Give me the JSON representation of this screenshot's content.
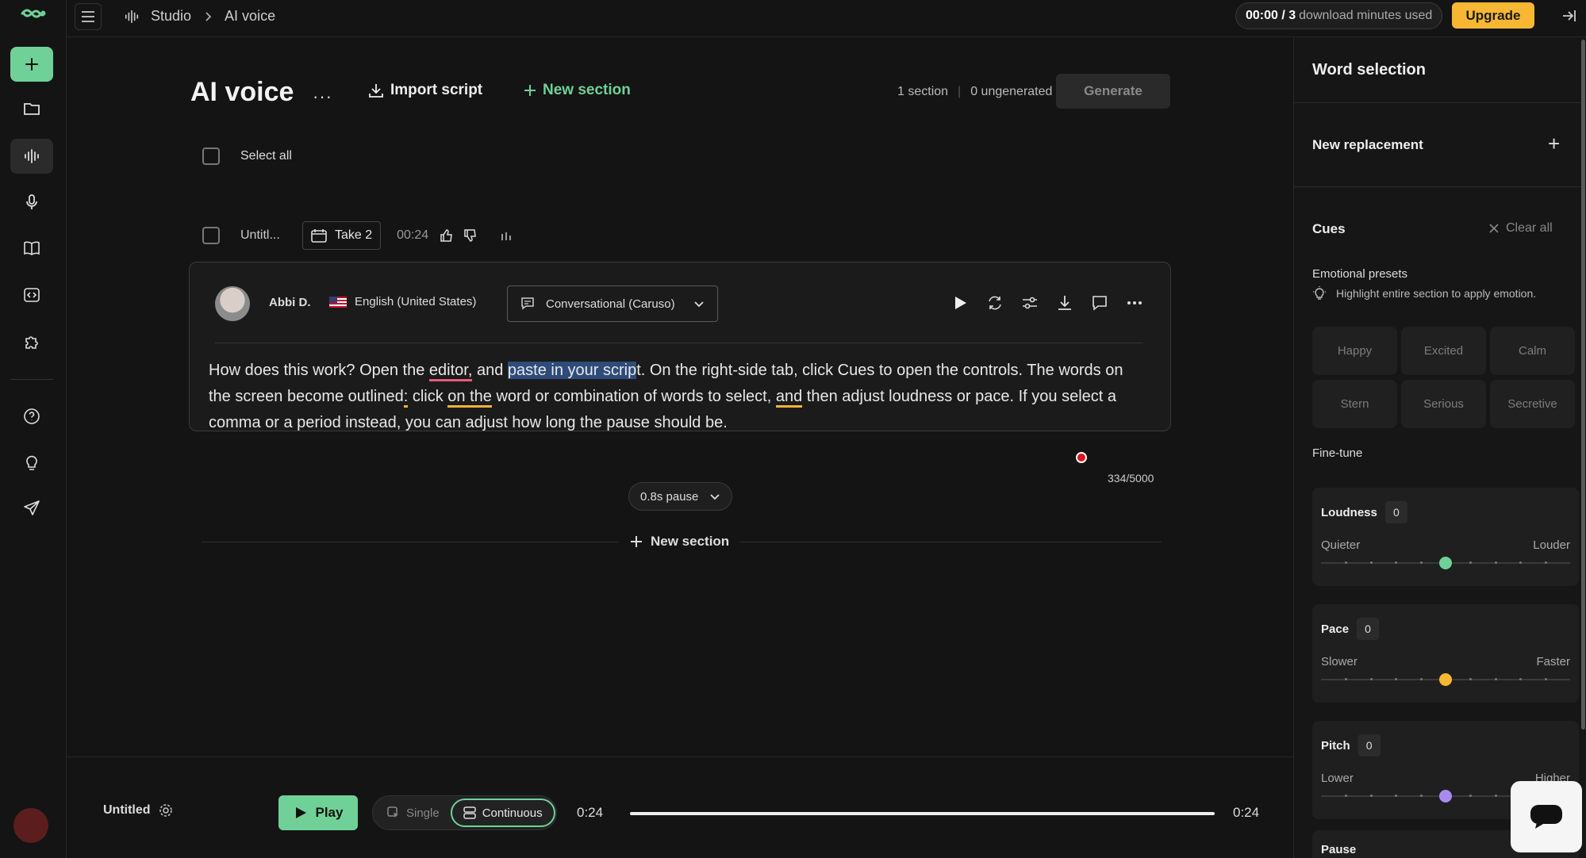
{
  "topbar": {
    "breadcrumb": [
      "Studio",
      "AI voice"
    ],
    "usage_time": "00:00 / 3",
    "usage_text": "download minutes used",
    "upgrade_label": "Upgrade"
  },
  "main": {
    "title": "AI voice",
    "more_label": "···",
    "import_label": "Import script",
    "new_section_label": "New section",
    "section_count": "1 section",
    "ungenerated_count": "0 ungenerated",
    "generate_label": "Generate",
    "select_all_label": "Select all",
    "section": {
      "name": "Untitl...",
      "take_label": "Take 2",
      "duration": "00:24"
    },
    "card": {
      "voice_name": "Abbi D.",
      "language": "English (United States)",
      "style": "Conversational (Caruso)",
      "script": {
        "p1": "How does this work? Open the ",
        "u1": "editor,",
        "p2": " and ",
        "hl1": "paste in your scrip",
        "p3": "t. On the right-side tab, click Cues to open the controls. The words on the screen become outlined",
        "u2": ":",
        "p4": " click ",
        "u3": "on the",
        "p5": " word or combination of words to select, ",
        "u4": "and",
        "p6": " then adjust loudness or pace. If you select a comma or a period instead, you can adjust how long the pause should be."
      },
      "char_count": "334/5000"
    },
    "pause_label": "0.8s pause",
    "new_section_bottom": "New section"
  },
  "player": {
    "doc_name": "Untitled",
    "play_label": "Play",
    "mode_single": "Single",
    "mode_continuous": "Continuous",
    "time_current": "0:24",
    "time_total": "0:24",
    "progress": 1.0
  },
  "panel": {
    "title": "Word selection",
    "new_replacement": "New replacement",
    "cues_title": "Cues",
    "clear_all": "Clear all",
    "emotional_presets_label": "Emotional presets",
    "emotional_hint": "Highlight entire section to apply emotion.",
    "presets": [
      "Happy",
      "Excited",
      "Calm",
      "Stern",
      "Serious",
      "Secretive"
    ],
    "fine_tune_label": "Fine-tune",
    "sliders": [
      {
        "name": "Loudness",
        "value": "0",
        "low": "Quieter",
        "high": "Louder",
        "position": 0.5,
        "color": "#6fd197"
      },
      {
        "name": "Pace",
        "value": "0",
        "low": "Slower",
        "high": "Faster",
        "position": 0.5,
        "color": "#f7b733"
      },
      {
        "name": "Pitch",
        "value": "0",
        "low": "Lower",
        "high": "Higher",
        "position": 0.5,
        "color": "#a98bf0"
      }
    ],
    "pause_title": "Pause"
  },
  "colors": {
    "accent": "#6fd197",
    "upgrade": "#f7b733"
  }
}
